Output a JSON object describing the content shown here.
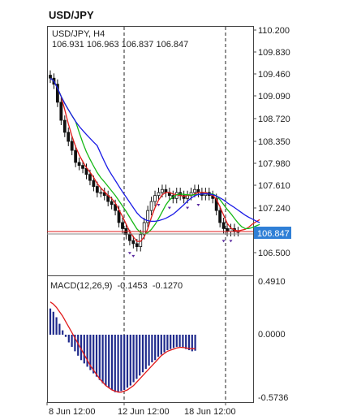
{
  "app_title": "USD/JPY",
  "symbol_label": "USD/JPY, H4",
  "ohlc_label": "106.931 106.963 106.837 106.847",
  "current_price": "106.847",
  "macd": {
    "label": "MACD(12,26,9)",
    "main_value": "-0.1453",
    "signal_value": "-0.1270"
  },
  "price_ticks": [
    "110.200",
    "109.830",
    "109.460",
    "109.090",
    "108.720",
    "108.350",
    "107.980",
    "107.610",
    "107.240",
    "106.500"
  ],
  "macd_ticks": [
    "0.4910",
    "0.0000",
    "-0.5736"
  ],
  "time_ticks": [
    "8 Jun 12:00",
    "12 Jun 12:00",
    "18 Jun 12:00"
  ],
  "colors": {
    "macd_histogram": "#1f2a8c",
    "macd_signal": "#e11b1b",
    "ma_fast": "#e11b1b",
    "ma_mid": "#16b816",
    "ma_slow": "#1a1ae6",
    "price_line": "#e11b1b",
    "price_badge": "#2f7fd6"
  },
  "chart_data": [
    {
      "type": "candlestick",
      "title": "USD/JPY, H4",
      "ylim": [
        106.2,
        110.25
      ],
      "close_series": [
        109.4,
        109.3,
        109.0,
        108.7,
        108.5,
        108.35,
        108.2,
        108.0,
        107.95,
        107.9,
        107.8,
        107.7,
        107.6,
        107.5,
        107.5,
        107.45,
        107.35,
        107.3,
        107.2,
        107.0,
        106.9,
        106.8,
        106.7,
        106.65,
        106.6,
        106.8,
        107.0,
        107.2,
        107.35,
        107.45,
        107.5,
        107.55,
        107.5,
        107.45,
        107.4,
        107.5,
        107.45,
        107.4,
        107.45,
        107.5,
        107.55,
        107.5,
        107.45,
        107.5,
        107.45,
        107.4,
        107.2,
        107.0,
        106.9,
        106.85,
        106.9,
        106.85,
        106.85
      ],
      "current_price": 106.847
    },
    {
      "type": "bar",
      "title": "MACD(12,26,9)",
      "ylim": [
        -0.5736,
        0.491
      ],
      "histogram": [
        0.24,
        0.21,
        0.16,
        0.1,
        0.04,
        -0.02,
        -0.07,
        -0.11,
        -0.15,
        -0.19,
        -0.23,
        -0.26,
        -0.29,
        -0.32,
        -0.35,
        -0.38,
        -0.41,
        -0.44,
        -0.46,
        -0.48,
        -0.5,
        -0.52,
        -0.52,
        -0.51,
        -0.5,
        -0.48,
        -0.46,
        -0.43,
        -0.4,
        -0.37,
        -0.34,
        -0.31,
        -0.28,
        -0.25,
        -0.23,
        -0.2,
        -0.18,
        -0.16,
        -0.14,
        -0.13,
        -0.12,
        -0.11,
        -0.11,
        -0.12,
        -0.13,
        -0.14,
        -0.15,
        -0.145
      ],
      "signal": [
        0.3,
        0.28,
        0.25,
        0.21,
        0.17,
        0.12,
        0.07,
        0.02,
        -0.03,
        -0.08,
        -0.13,
        -0.18,
        -0.23,
        -0.28,
        -0.32,
        -0.36,
        -0.4,
        -0.43,
        -0.46,
        -0.48,
        -0.5,
        -0.51,
        -0.52,
        -0.52,
        -0.51,
        -0.5,
        -0.48,
        -0.46,
        -0.43,
        -0.4,
        -0.37,
        -0.34,
        -0.31,
        -0.28,
        -0.25,
        -0.22,
        -0.19,
        -0.17,
        -0.15,
        -0.14,
        -0.13,
        -0.12,
        -0.115,
        -0.115,
        -0.12,
        -0.125,
        -0.127,
        -0.127
      ]
    }
  ]
}
